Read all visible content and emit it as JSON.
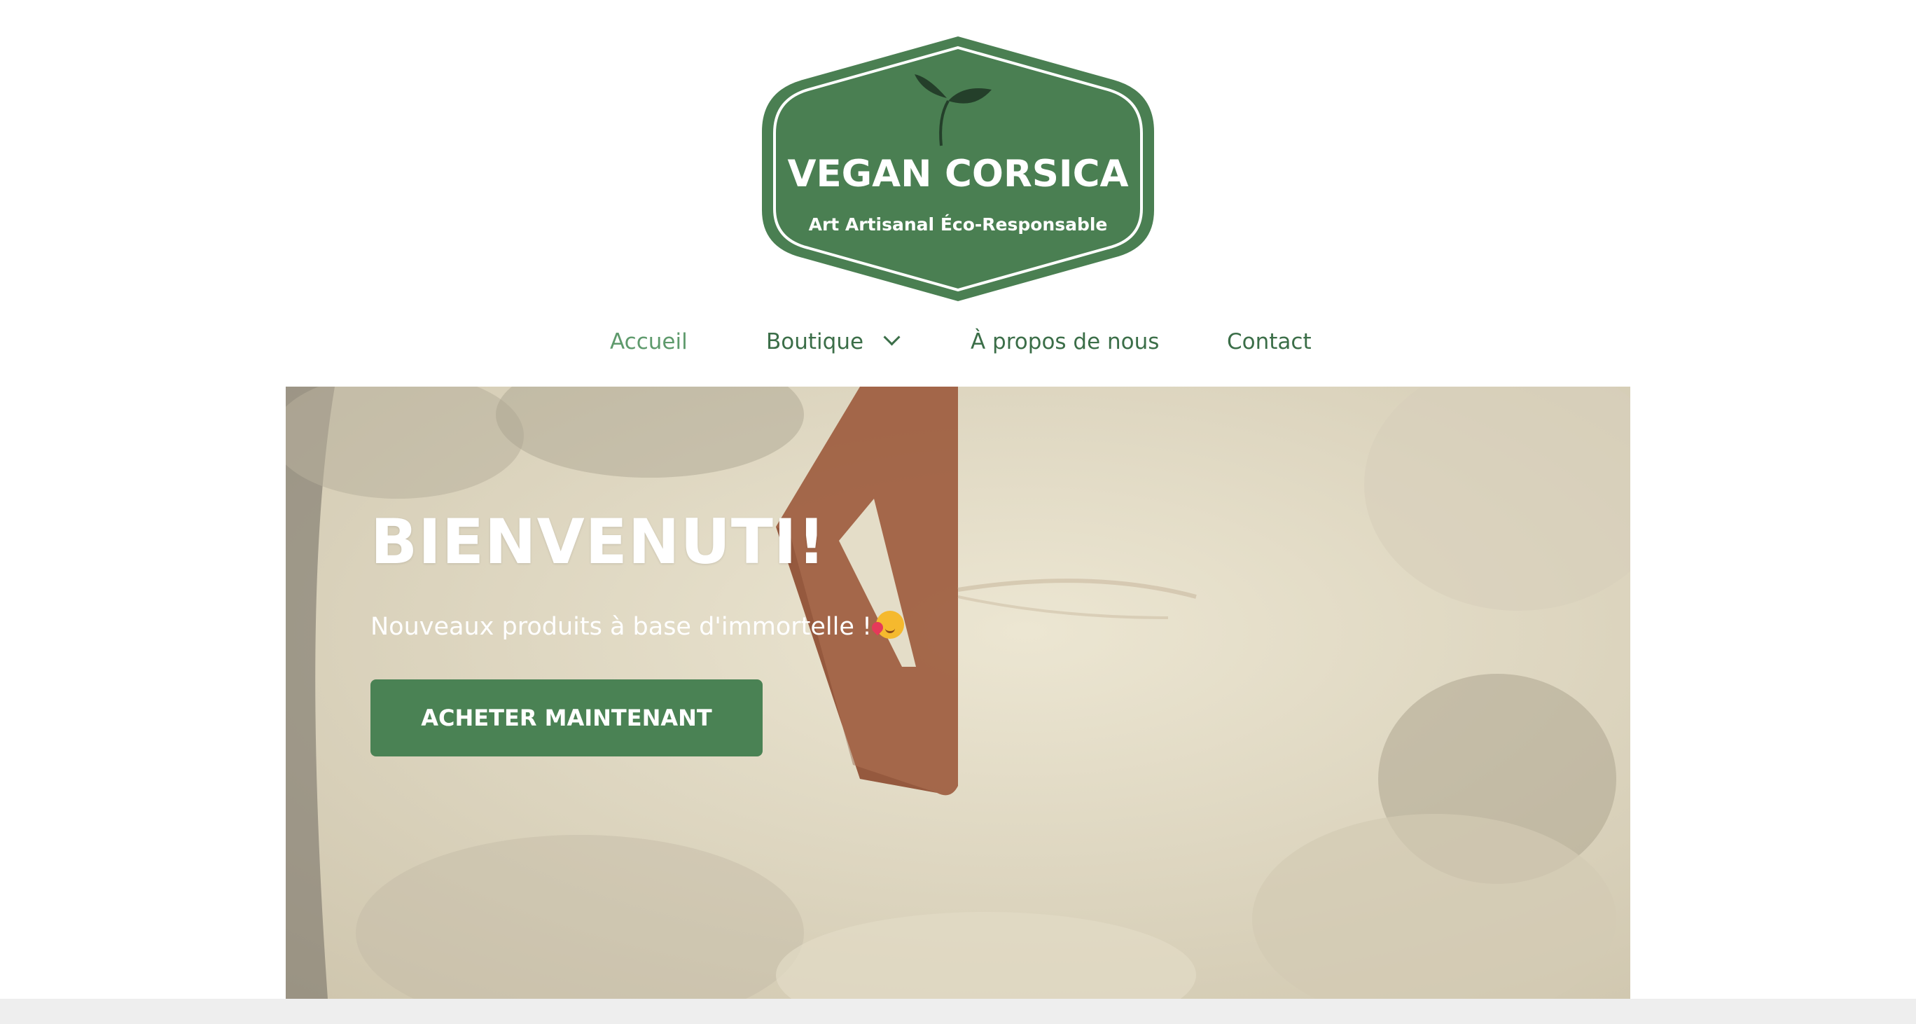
{
  "brand": {
    "title": "VEGAN CORSICA",
    "tagline": "Art Artisanal Éco-Responsable",
    "logo_color": "#4a7f52"
  },
  "nav": {
    "items": [
      {
        "label": "Accueil",
        "active": true
      },
      {
        "label": "Boutique",
        "has_dropdown": true
      },
      {
        "label": "À propos de nous"
      },
      {
        "label": "Contact"
      }
    ]
  },
  "hero": {
    "title": "BIENVENUTI!",
    "subtitle": "Nouveaux produits à base d'immortelle !",
    "subtitle_emoji": "smiling-face-with-hearts-icon",
    "cta_label": "ACHETER MAINTENANT",
    "cta_color": "#4a8254"
  }
}
